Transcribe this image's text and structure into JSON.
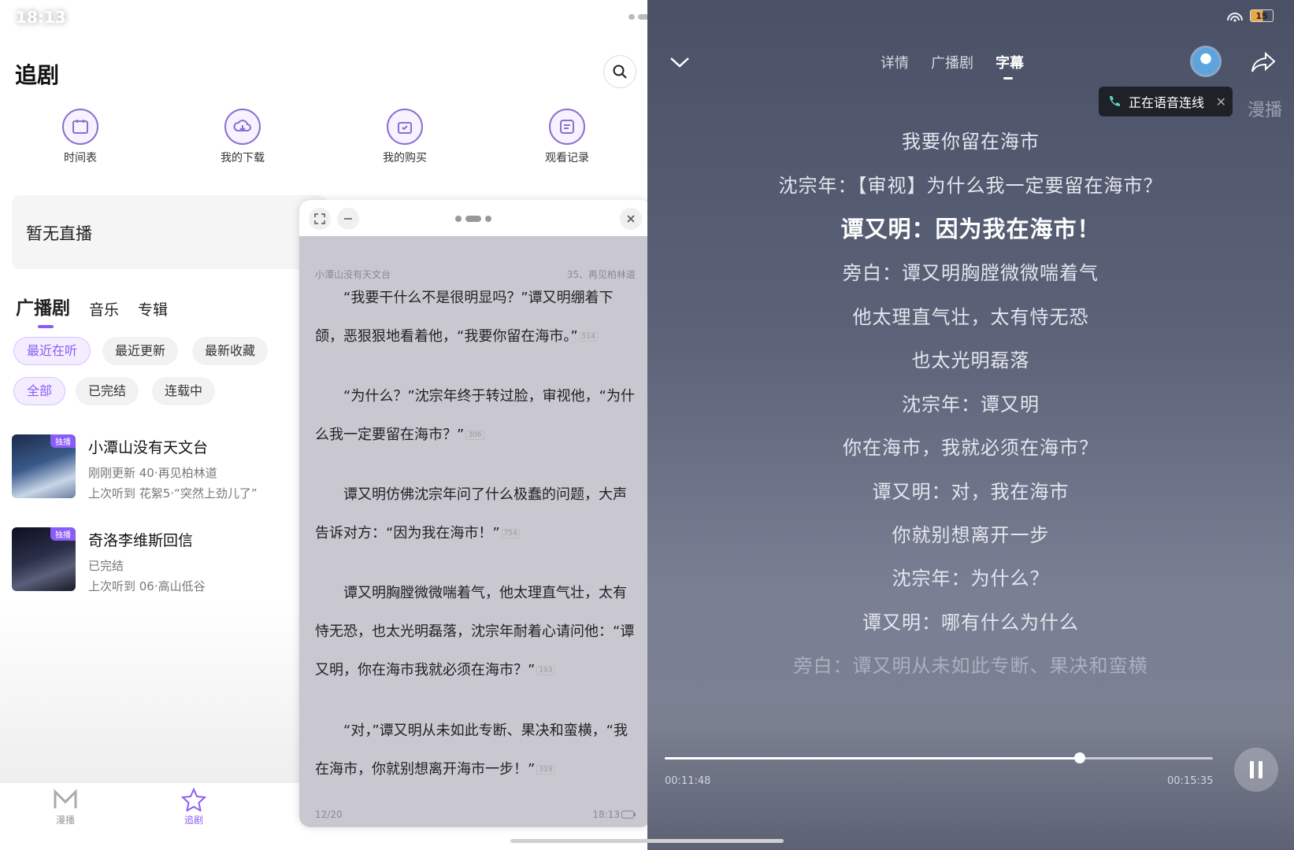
{
  "status": {
    "time": "18:13",
    "battery": "15"
  },
  "left": {
    "title": "追剧",
    "shortcuts": [
      {
        "label": "时间表",
        "icon": "calendar-icon"
      },
      {
        "label": "我的下载",
        "icon": "download-icon"
      },
      {
        "label": "我的购买",
        "icon": "purchase-icon"
      },
      {
        "label": "观看记录",
        "icon": "history-icon"
      }
    ],
    "live_card": "暂无直播",
    "tabs": [
      "广播剧",
      "音乐",
      "专辑"
    ],
    "sort_chips": [
      "最近在听",
      "最近更新",
      "最新收藏"
    ],
    "filter_chips": [
      "全部",
      "已完结",
      "连载中"
    ],
    "items": [
      {
        "name": "小潭山没有天文台",
        "badge": "独播",
        "sub": "刚刚更新 40·再见柏林道",
        "last": "上次听到 花絮5·“突然上劲儿了”"
      },
      {
        "name": "奇洛李维斯回信",
        "badge": "独播",
        "sub": "已完结",
        "last": "上次听到 06·高山低谷"
      }
    ],
    "nav": [
      "漫播",
      "追剧"
    ]
  },
  "reader": {
    "book": "小潭山没有天文台",
    "chapter": "35、再见柏林道",
    "paragraphs": [
      {
        "text": "“我要干什么不是很明显吗？”谭又明绷着下颌，恶狠狠地看着他，“我要你留在海市。”",
        "count": "514"
      },
      {
        "text": "“为什么？”沈宗年终于转过脸，审视他，“为什么我一定要留在海市？”",
        "count": "306"
      },
      {
        "text": "谭又明仿佛沈宗年问了什么极蠢的问题，大声告诉对方：“因为我在海市！”",
        "count": "754"
      },
      {
        "text": "谭又明胸膛微微喘着气，他太理直气壮，太有恃无恐，也太光明磊落，沈宗年耐着心请问他：“谭又明，你在海市我就必须在海市？”",
        "count": "193"
      },
      {
        "text": "“对，”谭又明从未如此专断、果决和蛮横，“我在海市，你就别想离开海市一步！”",
        "count": "319"
      }
    ],
    "page": "12/20",
    "clock": "18:13"
  },
  "player": {
    "tabs": [
      "详情",
      "广播剧",
      "字幕"
    ],
    "active_tab": "字幕",
    "call_status": "正在语音连线",
    "manbo_label": "漫播",
    "lyrics": [
      "我要你留在海市",
      "沈宗年：【审视】为什么我一定要留在海市？",
      "谭又明：因为我在海市！",
      "旁白：谭又明胸膛微微喘着气",
      "他太理直气壮，太有恃无恐",
      "也太光明磊落",
      "沈宗年：谭又明",
      "你在海市，我就必须在海市？",
      "谭又明：对，我在海市",
      "你就别想离开一步",
      "沈宗年：为什么？",
      "谭又明：哪有什么为什么",
      "旁白：谭又明从未如此专断、果决和蛮横"
    ],
    "current_lyric_index": 2,
    "time_current": "00:11:48",
    "time_total": "00:15:35",
    "progress_fraction": 0.757
  }
}
